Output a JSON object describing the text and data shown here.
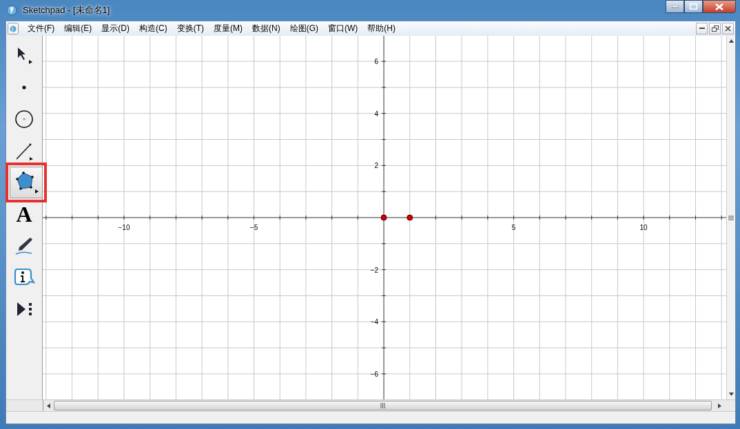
{
  "window": {
    "title": "Sketchpad  - [未命名1]"
  },
  "menu": [
    "文件(F)",
    "编辑(E)",
    "显示(D)",
    "构造(C)",
    "变换(T)",
    "度量(M)",
    "数据(N)",
    "绘图(G)",
    "窗口(W)",
    "帮助(H)"
  ],
  "toolbar": [
    {
      "kind": "arrow",
      "selected": false
    },
    {
      "kind": "point",
      "selected": false
    },
    {
      "kind": "compass",
      "selected": false
    },
    {
      "kind": "line",
      "selected": false
    },
    {
      "kind": "polygon",
      "selected": true
    },
    {
      "kind": "text",
      "label": "A",
      "selected": false
    },
    {
      "kind": "marker",
      "selected": false
    },
    {
      "kind": "info",
      "selected": false
    },
    {
      "kind": "custom",
      "selected": false
    }
  ],
  "canvas": {
    "chart_data": {
      "type": "scatter",
      "x": [
        0,
        1
      ],
      "grid": true,
      "series": [
        {
          "color": "#d40000",
          "values": [
            0,
            0
          ]
        }
      ],
      "xlim": [
        -13.13,
        13.18
      ],
      "ylim": [
        -6.98,
        6.98
      ],
      "xticks": [
        {
          "value": -10,
          "label": "−10"
        },
        {
          "value": -5,
          "label": "−5"
        },
        {
          "value": 5,
          "label": "5"
        },
        {
          "value": 10,
          "label": "10"
        }
      ],
      "yticks": [
        {
          "value": 6,
          "label": "6"
        },
        {
          "value": 4,
          "label": "4"
        },
        {
          "value": 2,
          "label": "2"
        },
        {
          "value": -2,
          "label": "−2"
        },
        {
          "value": -4,
          "label": "−4"
        },
        {
          "value": -6,
          "label": "−6"
        }
      ]
    }
  }
}
